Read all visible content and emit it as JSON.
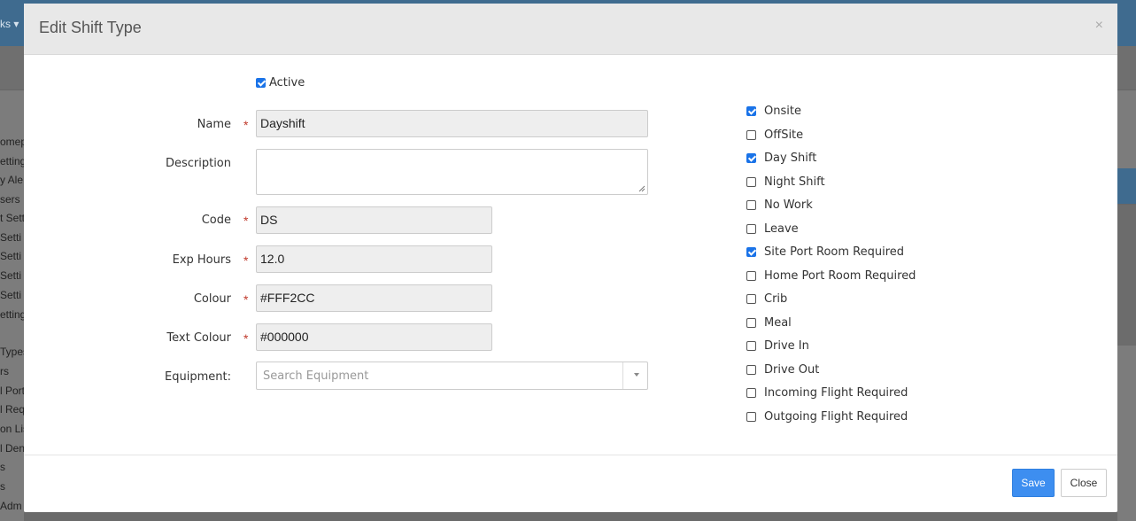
{
  "background": {
    "topbar_item": "ks ▾",
    "sidebar_items": [
      "omep",
      "etting",
      "y Ale",
      "sers",
      "t Sett",
      "Setti",
      "Setti",
      "Setti",
      "Setti",
      "etting",
      "Types",
      "rs",
      "l Port",
      "l Requ",
      "on Lis",
      "l Den",
      "s",
      "s",
      "Adm"
    ]
  },
  "modal": {
    "title": "Edit Shift Type",
    "close_icon": "×"
  },
  "form": {
    "active_label": "Active",
    "active_checked": true,
    "name_label": "Name",
    "name_value": "Dayshift",
    "description_label": "Description",
    "description_value": "",
    "code_label": "Code",
    "code_value": "DS",
    "exp_hours_label": "Exp Hours",
    "exp_hours_value": "12.0",
    "colour_label": "Colour",
    "colour_value": "#FFF2CC",
    "text_colour_label": "Text Colour",
    "text_colour_value": "#000000",
    "equipment_label": "Equipment:",
    "equipment_placeholder": "Search Equipment",
    "required_mark": "*"
  },
  "options": [
    {
      "label": "Onsite",
      "checked": true
    },
    {
      "label": "OffSite",
      "checked": false
    },
    {
      "label": "Day Shift",
      "checked": true
    },
    {
      "label": "Night Shift",
      "checked": false
    },
    {
      "label": "No Work",
      "checked": false
    },
    {
      "label": "Leave",
      "checked": false
    },
    {
      "label": "Site Port Room Required",
      "checked": true
    },
    {
      "label": "Home Port Room Required",
      "checked": false
    },
    {
      "label": "Crib",
      "checked": false
    },
    {
      "label": "Meal",
      "checked": false
    },
    {
      "label": "Drive In",
      "checked": false
    },
    {
      "label": "Drive Out",
      "checked": false
    },
    {
      "label": "Incoming Flight Required",
      "checked": false
    },
    {
      "label": "Outgoing Flight Required",
      "checked": false
    }
  ],
  "footer": {
    "save_label": "Save",
    "close_label": "Close"
  },
  "colors": {
    "accent": "#3d8ef0",
    "required": "#c0392b",
    "checkbox_checked": "#1a73e8"
  }
}
